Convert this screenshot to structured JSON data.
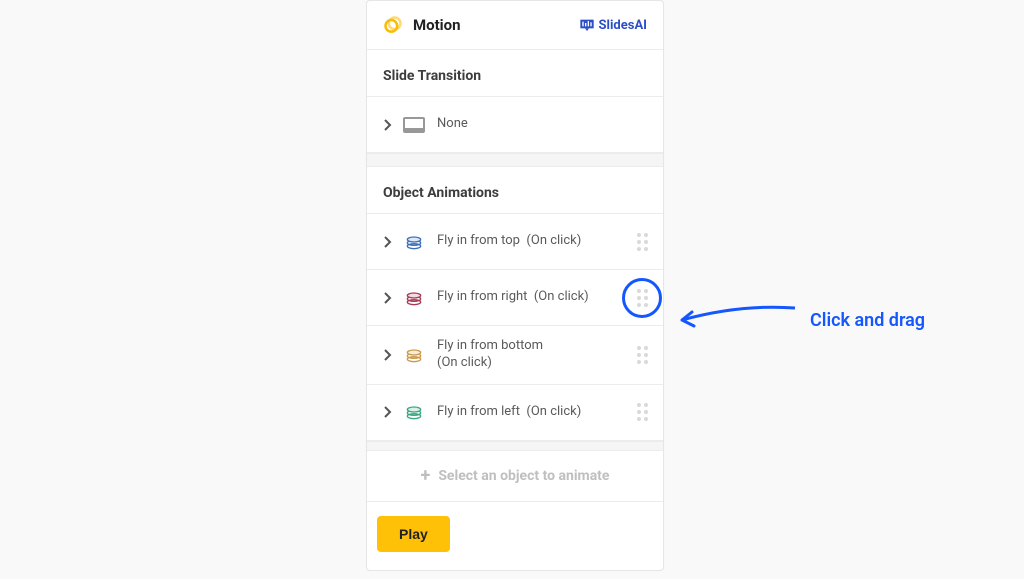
{
  "header": {
    "title": "Motion",
    "brand": "SlidesAI"
  },
  "sections": {
    "transition_title": "Slide Transition",
    "transition_value": "None",
    "animations_title": "Object Animations"
  },
  "animations": [
    {
      "label": "Fly in from top",
      "trigger": "(On click)",
      "color": "#3b6fb8"
    },
    {
      "label": "Fly in from right",
      "trigger": "(On click)",
      "color": "#a93a56"
    },
    {
      "label": "Fly in from bottom",
      "trigger": "(On click)",
      "color": "#c99a4e"
    },
    {
      "label": "Fly in from left",
      "trigger": "(On click)",
      "color": "#3aa780"
    }
  ],
  "add_row": {
    "label": "Select an object to animate"
  },
  "footer": {
    "play": "Play"
  },
  "annotation": {
    "text": "Click and drag"
  }
}
